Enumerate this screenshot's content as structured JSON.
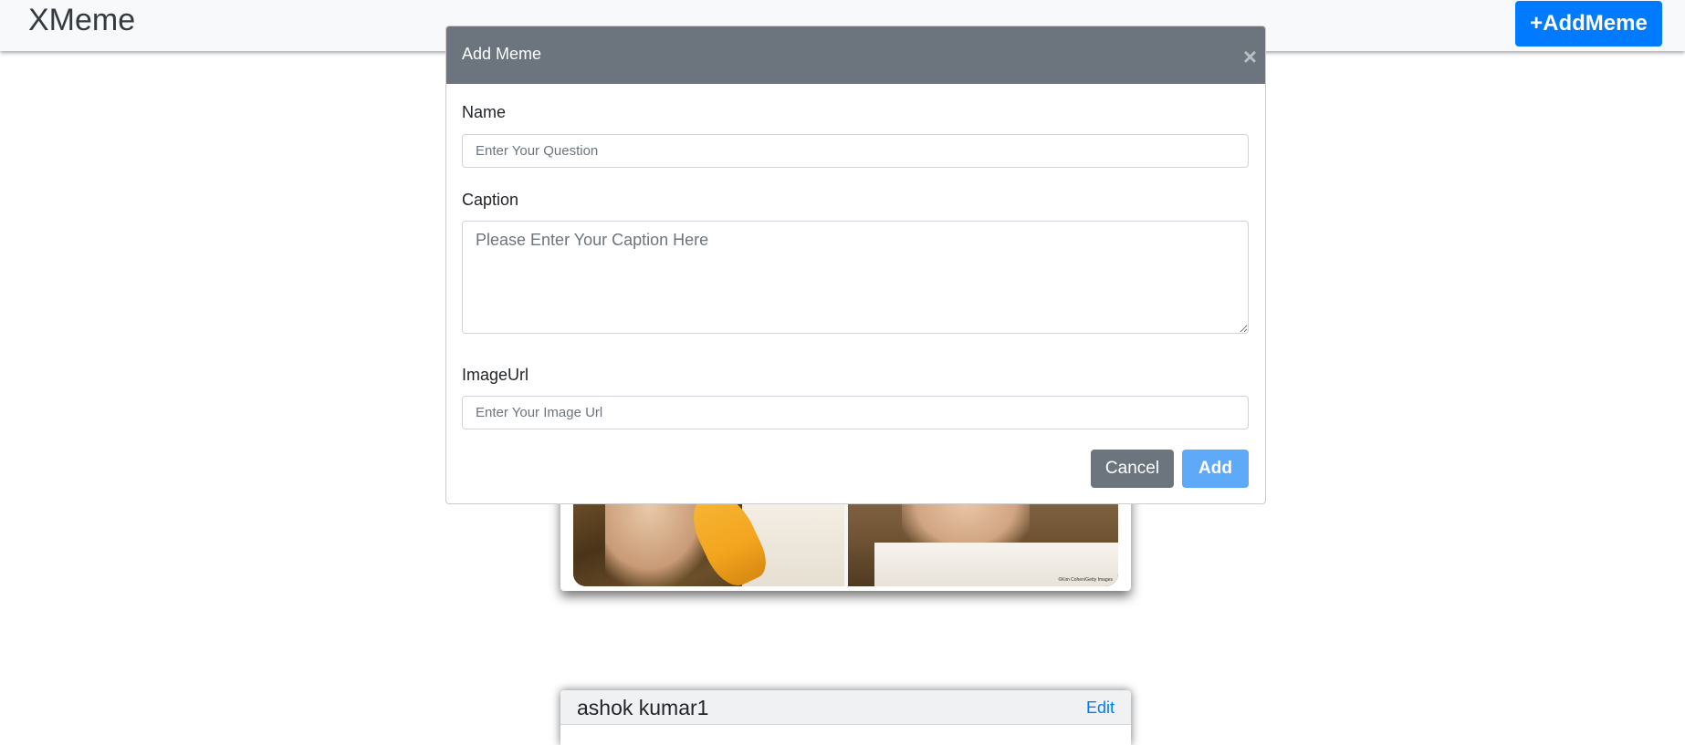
{
  "navbar": {
    "brand": "XMeme",
    "add_button_label": "+AddMeme"
  },
  "meme_cards": [
    {
      "image_credit": "©Kim Cohen/Getty Images"
    },
    {
      "name": "ashok kumar1",
      "edit_label": "Edit"
    }
  ],
  "modal": {
    "title": "Add Meme",
    "close_symbol": "×",
    "name_label": "Name",
    "name_placeholder": "Enter Your Question",
    "name_value": "",
    "caption_label": "Caption",
    "caption_placeholder": "Please Enter Your Caption Here",
    "caption_value": "",
    "image_url_label": "ImageUrl",
    "image_url_placeholder": "Enter Your Image Url",
    "image_url_value": "",
    "cancel_label": "Cancel",
    "add_label": "Add"
  },
  "colors": {
    "primary": "#007bff",
    "secondary": "#6c757d",
    "add_button_disabled": "#5eaaf8",
    "navbar_bg": "#f8f9fa"
  }
}
